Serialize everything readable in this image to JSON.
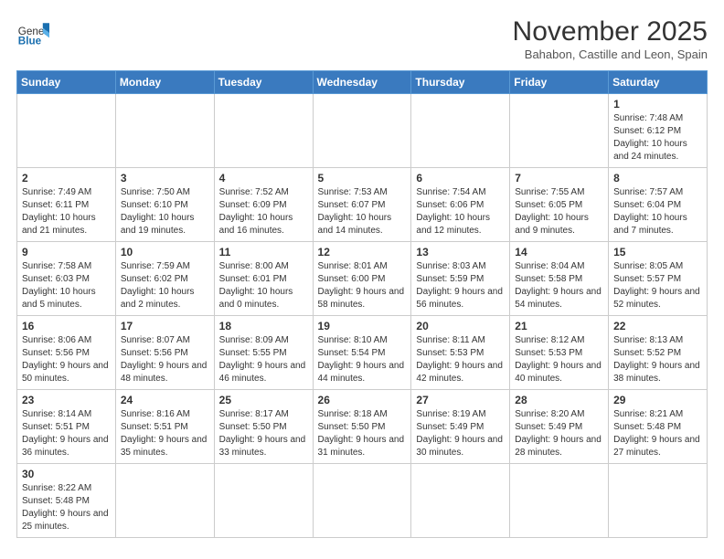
{
  "header": {
    "logo_general": "General",
    "logo_blue": "Blue",
    "month_title": "November 2025",
    "subtitle": "Bahabon, Castille and Leon, Spain"
  },
  "days_of_week": [
    "Sunday",
    "Monday",
    "Tuesday",
    "Wednesday",
    "Thursday",
    "Friday",
    "Saturday"
  ],
  "weeks": [
    [
      null,
      null,
      null,
      null,
      null,
      null,
      {
        "day": "1",
        "sunrise": "7:48 AM",
        "sunset": "6:12 PM",
        "daylight": "10 hours and 24 minutes."
      }
    ],
    [
      {
        "day": "2",
        "sunrise": "7:49 AM",
        "sunset": "6:11 PM",
        "daylight": "10 hours and 21 minutes."
      },
      {
        "day": "3",
        "sunrise": "7:50 AM",
        "sunset": "6:10 PM",
        "daylight": "10 hours and 19 minutes."
      },
      {
        "day": "4",
        "sunrise": "7:52 AM",
        "sunset": "6:09 PM",
        "daylight": "10 hours and 16 minutes."
      },
      {
        "day": "5",
        "sunrise": "7:53 AM",
        "sunset": "6:07 PM",
        "daylight": "10 hours and 14 minutes."
      },
      {
        "day": "6",
        "sunrise": "7:54 AM",
        "sunset": "6:06 PM",
        "daylight": "10 hours and 12 minutes."
      },
      {
        "day": "7",
        "sunrise": "7:55 AM",
        "sunset": "6:05 PM",
        "daylight": "10 hours and 9 minutes."
      },
      {
        "day": "8",
        "sunrise": "7:57 AM",
        "sunset": "6:04 PM",
        "daylight": "10 hours and 7 minutes."
      }
    ],
    [
      {
        "day": "9",
        "sunrise": "7:58 AM",
        "sunset": "6:03 PM",
        "daylight": "10 hours and 5 minutes."
      },
      {
        "day": "10",
        "sunrise": "7:59 AM",
        "sunset": "6:02 PM",
        "daylight": "10 hours and 2 minutes."
      },
      {
        "day": "11",
        "sunrise": "8:00 AM",
        "sunset": "6:01 PM",
        "daylight": "10 hours and 0 minutes."
      },
      {
        "day": "12",
        "sunrise": "8:01 AM",
        "sunset": "6:00 PM",
        "daylight": "9 hours and 58 minutes."
      },
      {
        "day": "13",
        "sunrise": "8:03 AM",
        "sunset": "5:59 PM",
        "daylight": "9 hours and 56 minutes."
      },
      {
        "day": "14",
        "sunrise": "8:04 AM",
        "sunset": "5:58 PM",
        "daylight": "9 hours and 54 minutes."
      },
      {
        "day": "15",
        "sunrise": "8:05 AM",
        "sunset": "5:57 PM",
        "daylight": "9 hours and 52 minutes."
      }
    ],
    [
      {
        "day": "16",
        "sunrise": "8:06 AM",
        "sunset": "5:56 PM",
        "daylight": "9 hours and 50 minutes."
      },
      {
        "day": "17",
        "sunrise": "8:07 AM",
        "sunset": "5:56 PM",
        "daylight": "9 hours and 48 minutes."
      },
      {
        "day": "18",
        "sunrise": "8:09 AM",
        "sunset": "5:55 PM",
        "daylight": "9 hours and 46 minutes."
      },
      {
        "day": "19",
        "sunrise": "8:10 AM",
        "sunset": "5:54 PM",
        "daylight": "9 hours and 44 minutes."
      },
      {
        "day": "20",
        "sunrise": "8:11 AM",
        "sunset": "5:53 PM",
        "daylight": "9 hours and 42 minutes."
      },
      {
        "day": "21",
        "sunrise": "8:12 AM",
        "sunset": "5:53 PM",
        "daylight": "9 hours and 40 minutes."
      },
      {
        "day": "22",
        "sunrise": "8:13 AM",
        "sunset": "5:52 PM",
        "daylight": "9 hours and 38 minutes."
      }
    ],
    [
      {
        "day": "23",
        "sunrise": "8:14 AM",
        "sunset": "5:51 PM",
        "daylight": "9 hours and 36 minutes."
      },
      {
        "day": "24",
        "sunrise": "8:16 AM",
        "sunset": "5:51 PM",
        "daylight": "9 hours and 35 minutes."
      },
      {
        "day": "25",
        "sunrise": "8:17 AM",
        "sunset": "5:50 PM",
        "daylight": "9 hours and 33 minutes."
      },
      {
        "day": "26",
        "sunrise": "8:18 AM",
        "sunset": "5:50 PM",
        "daylight": "9 hours and 31 minutes."
      },
      {
        "day": "27",
        "sunrise": "8:19 AM",
        "sunset": "5:49 PM",
        "daylight": "9 hours and 30 minutes."
      },
      {
        "day": "28",
        "sunrise": "8:20 AM",
        "sunset": "5:49 PM",
        "daylight": "9 hours and 28 minutes."
      },
      {
        "day": "29",
        "sunrise": "8:21 AM",
        "sunset": "5:48 PM",
        "daylight": "9 hours and 27 minutes."
      }
    ],
    [
      {
        "day": "30",
        "sunrise": "8:22 AM",
        "sunset": "5:48 PM",
        "daylight": "9 hours and 25 minutes."
      },
      null,
      null,
      null,
      null,
      null,
      null
    ]
  ]
}
